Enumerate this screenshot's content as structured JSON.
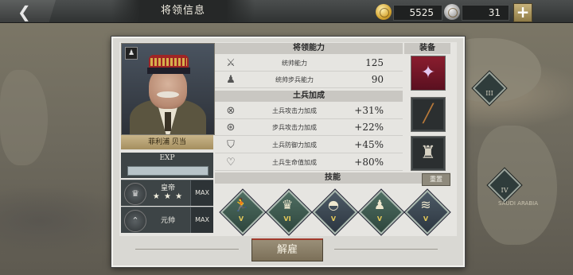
{
  "topbar": {
    "title": "将领信息",
    "back_icon": "chevron-left-icon",
    "gold": "5525",
    "medals": "31",
    "plus_label": "+"
  },
  "map": {
    "markers": [
      "III",
      "IV"
    ],
    "place_label": "SAUDI ARABIA"
  },
  "general": {
    "name": "菲利浦 贝当",
    "exp_label": "EXP",
    "exp_progress": 0
  },
  "ranks": [
    {
      "title": "皇帝",
      "stars": "★ ★ ★",
      "max": "MAX",
      "emblem": "crown-icon"
    },
    {
      "title": "元帅",
      "stars": "",
      "max": "MAX",
      "emblem": "rank-chevron-icon"
    }
  ],
  "sections": {
    "abilities": "将领能力",
    "equipment": "装备",
    "soldier_bonus": "土兵加成",
    "skills": "技能",
    "reset": "重置"
  },
  "abilities": [
    {
      "icon": "crossed-swords-icon",
      "label": "统帅能力",
      "value": "125"
    },
    {
      "icon": "infantry-icon",
      "label": "统帅步兵能力",
      "value": "90"
    }
  ],
  "bonuses": [
    {
      "icon": "attack-icon",
      "label": "土兵攻击力加成",
      "value": "+31%"
    },
    {
      "icon": "infantry-attack-icon",
      "label": "步兵攻击力加成",
      "value": "+22%"
    },
    {
      "icon": "defense-icon",
      "label": "土兵防御力加成",
      "value": "+45%"
    },
    {
      "icon": "heart-icon",
      "label": "土兵生命值加成",
      "value": "+80%"
    }
  ],
  "equipment": [
    {
      "name": "medal-icon",
      "glyph": "🎖"
    },
    {
      "name": "rifle-icon",
      "glyph": "⟋"
    },
    {
      "name": "bottle-icon",
      "glyph": "🍾"
    }
  ],
  "skills": [
    {
      "name": "charge-skill-icon",
      "level": "V"
    },
    {
      "name": "laurel-skill-icon",
      "level": "VI"
    },
    {
      "name": "helmet-skill-icon",
      "level": "V"
    },
    {
      "name": "infantry-skill-icon",
      "level": "V"
    },
    {
      "name": "fortify-skill-icon",
      "level": "V"
    }
  ],
  "dismiss_label": "解雇"
}
